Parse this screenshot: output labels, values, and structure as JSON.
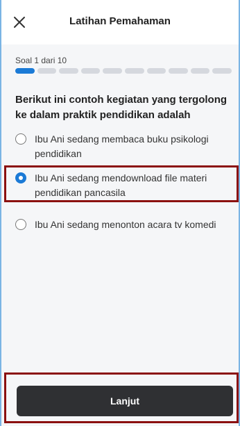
{
  "header": {
    "title": "Latihan Pemahaman",
    "close_icon": "close-icon"
  },
  "quiz": {
    "counter": "Soal 1 dari 10",
    "total_segments": 10,
    "current_segment": 1,
    "question": "Berikut ini contoh kegiatan yang tergolong ke dalam praktik pendidikan adalah",
    "options": [
      {
        "label": "Ibu Ani sedang membaca buku psikologi pendidikan",
        "selected": false
      },
      {
        "label": "Ibu Ani sedang mendownload file materi pendidikan pancasila",
        "selected": true
      },
      {
        "label": "Ibu Ani sedang menonton acara tv komedi",
        "selected": false
      }
    ]
  },
  "footer": {
    "next_label": "Lanjut"
  },
  "colors": {
    "accent": "#1b7ad6",
    "button_bg": "#2f3033",
    "highlight_border": "#8b1010",
    "page_bg": "#f5f6f8"
  }
}
